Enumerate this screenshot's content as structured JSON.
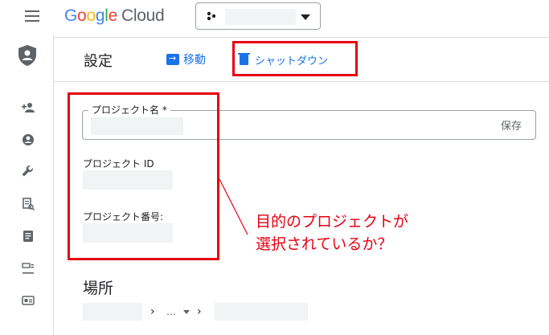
{
  "topbar": {
    "logo": {
      "g1": "G",
      "g2": "o",
      "g3": "o",
      "g4": "g",
      "g5": "l",
      "g6": "e",
      "cloud": "Cloud"
    }
  },
  "header": {
    "title": "設定",
    "move_label": "移動",
    "shutdown_label": "シャットダウン"
  },
  "form": {
    "project_name_label": "プロジェクト名 *",
    "save_label": "保存",
    "project_id_label": "プロジェクト ID",
    "project_number_label": "プロジェクト番号:"
  },
  "annotation": {
    "line1": "目的のプロジェクトが",
    "line2": "選択されているか？"
  },
  "location": {
    "title": "場所",
    "sep1": "›",
    "ellipsis": "…",
    "sep2": "›"
  },
  "icons": {
    "rail": [
      "person-add-icon",
      "account-circle-icon",
      "wrench-icon",
      "document-search-icon",
      "notes-icon",
      "label-icon",
      "id-card-icon"
    ]
  },
  "colors": {
    "accent": "#1a73e8",
    "annotation": "#e60012"
  }
}
